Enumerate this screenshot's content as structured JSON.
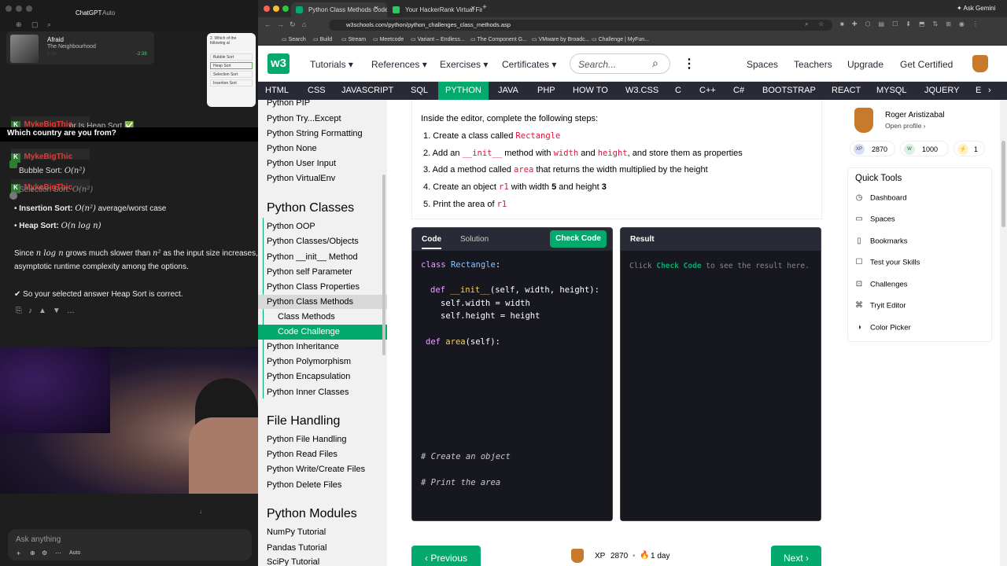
{
  "left_panel": {
    "app_title": "ChatGPT",
    "app_mode": "Auto",
    "music": {
      "title": "Afraid",
      "artist": "The Neighbourhood",
      "time_elapsed": "1:34",
      "time_left": "-2:38"
    },
    "chat_overlays": [
      {
        "user": "MykeBigThic",
        "text": "Which country are you from?"
      },
      {
        "user": "MykeBigThic",
        "text": ""
      },
      {
        "user": "MykeBigThic",
        "text": ""
      }
    ],
    "partial_lines": [
      "or Is Heap Sort ✅",
      "Bubble Sort:",
      "Selection Sort:"
    ],
    "math_lines": [
      {
        "label": "Insertion Sort:",
        "expr": "O(n²)",
        "suffix": "average/worst case"
      },
      {
        "label": "Heap Sort:",
        "expr": "O(n log n)",
        "suffix": ""
      }
    ],
    "bubble_expr": "O(n²)",
    "selection_expr": "O(n²)",
    "para1_a": "Since",
    "para1_expr": "n log n",
    "para1_b": "grows much slower than",
    "para1_expr2": "n²",
    "para1_c": "as the input size increases,",
    "para2": "asymptotic runtime complexity among the options.",
    "conclusion": "✔ So your selected answer Heap Sort is correct.",
    "prompt_placeholder": "Ask anything",
    "prompt_mode": "Auto",
    "quiz_card_title": "2. Which of the following al",
    "quiz_options": [
      "Bubble Sort",
      "Heap Sort",
      "Selection Sort",
      "Insertion Sort"
    ]
  },
  "browser": {
    "tabs": [
      {
        "title": "Python Class Methods Code",
        "active": true
      },
      {
        "title": "Your HackerRank Virtual Fin...",
        "active": false
      }
    ],
    "ask_label": "Ask Gemini",
    "url": "w3schools.com/python/python_challenges_class_methods.asp",
    "bookmarks": [
      "Search",
      "Build",
      "Stream",
      "Meetcode",
      "Variant – Endless...",
      "The Component G...",
      "VMware by Broadc...",
      "Challenge | MyFun..."
    ]
  },
  "w3nav": {
    "logo": "w3",
    "logo_sup": "3",
    "items": [
      "Tutorials",
      "References",
      "Exercises",
      "Certificates"
    ],
    "search_placeholder": "Search...",
    "right": [
      "Spaces",
      "Teachers",
      "Upgrade",
      "Get Certified"
    ]
  },
  "languages": [
    "HTML",
    "CSS",
    "JAVASCRIPT",
    "SQL",
    "PYTHON",
    "JAVA",
    "PHP",
    "HOW TO",
    "W3.CSS",
    "C",
    "C++",
    "C#",
    "BOOTSTRAP",
    "REACT",
    "MYSQL",
    "JQUERY",
    "E"
  ],
  "sidebar": {
    "items_top": [
      "Python PIP",
      "Python Try...Except",
      "Python String Formatting",
      "Python None",
      "Python User Input",
      "Python VirtualEnv"
    ],
    "heading_classes": "Python Classes",
    "items_classes": [
      "Python OOP",
      "Python Classes/Objects",
      "Python __init__ Method",
      "Python self Parameter",
      "Python Class Properties",
      "Python Class Methods"
    ],
    "sub_items": [
      "Class Methods",
      "Code Challenge"
    ],
    "items_classes2": [
      "Python Inheritance",
      "Python Polymorphism",
      "Python Encapsulation",
      "Python Inner Classes"
    ],
    "heading_files": "File Handling",
    "items_files": [
      "Python File Handling",
      "Python Read Files",
      "Python Write/Create Files",
      "Python Delete Files"
    ],
    "heading_modules": "Python Modules",
    "items_modules": [
      "NumPy Tutorial",
      "Pandas Tutorial",
      "SciPy Tutorial"
    ]
  },
  "challenge": {
    "intro": "Inside the editor, complete the following steps:",
    "steps": [
      {
        "n": "1.",
        "a": "Create a class called",
        "code1": "Rectangle",
        "b": "",
        "code2": "",
        "c": ""
      },
      {
        "n": "2.",
        "a": "Add an",
        "code1": "__init__",
        "b": "method with",
        "code2": "width",
        "c": "and",
        "code3": "height",
        "d": ", and store them as properties"
      },
      {
        "n": "3.",
        "a": "Add a method called",
        "code1": "area",
        "b": "that returns the width multiplied by the height",
        "code2": "",
        "c": ""
      },
      {
        "n": "4.",
        "a": "Create an object",
        "code1": "r1",
        "b": "with width",
        "bold1": "5",
        "c": "and height",
        "bold2": "3"
      },
      {
        "n": "5.",
        "a": "Print the area of",
        "code1": "r1",
        "b": "",
        "code2": "",
        "c": ""
      }
    ],
    "tab_code": "Code",
    "tab_solution": "Solution",
    "check_button": "Check Code",
    "result_title": "Result",
    "result_a": "Click",
    "result_b": "Check Code",
    "result_c": "to see the result here.",
    "code_lines": {
      "l1_kw": "class",
      "l1_name": "Rectangle",
      "l1_end": ":",
      "l2_kw": "def",
      "l2_fn": "__init__",
      "l2_args": "(self, width, height):",
      "l3": "self.width = width",
      "l4": "self.height = height",
      "l5_kw": "def",
      "l5_fn": "area",
      "l5_args": "(self):",
      "c1": "# Create an object",
      "c2": "# Print the area"
    },
    "prev_button": "Previous",
    "next_button": "Next",
    "xp_label": "XP",
    "xp_value": "2870",
    "streak": "1 day"
  },
  "profile": {
    "name": "Roger Aristizabal",
    "link": "Open profile",
    "badges": [
      {
        "label": "XP",
        "value": "2870",
        "color": "#d9def8"
      },
      {
        "label": "W",
        "value": "1000",
        "color": "#d9f2e3"
      },
      {
        "label": "⚡",
        "value": "1",
        "color": "#fdf2cc"
      }
    ]
  },
  "quick_tools": {
    "title": "Quick Tools",
    "items": [
      {
        "icon": "dashboard-icon",
        "label": "Dashboard"
      },
      {
        "icon": "spaces-icon",
        "label": "Spaces"
      },
      {
        "icon": "bookmark-icon",
        "label": "Bookmarks"
      },
      {
        "icon": "test-icon",
        "label": "Test your Skills"
      },
      {
        "icon": "challenge-icon",
        "label": "Challenges"
      },
      {
        "icon": "editor-icon",
        "label": "Tryit Editor"
      },
      {
        "icon": "palette-icon",
        "label": "Color Picker"
      }
    ]
  },
  "colors": {
    "w3_green": "#04aa6d",
    "w3_dark": "#282a35",
    "code_bg": "#1e1f2b",
    "code_comment": "#c9c9c9",
    "kw": "#e8a3ff",
    "fn": "#f2d36b",
    "type": "#8cc4ff"
  }
}
